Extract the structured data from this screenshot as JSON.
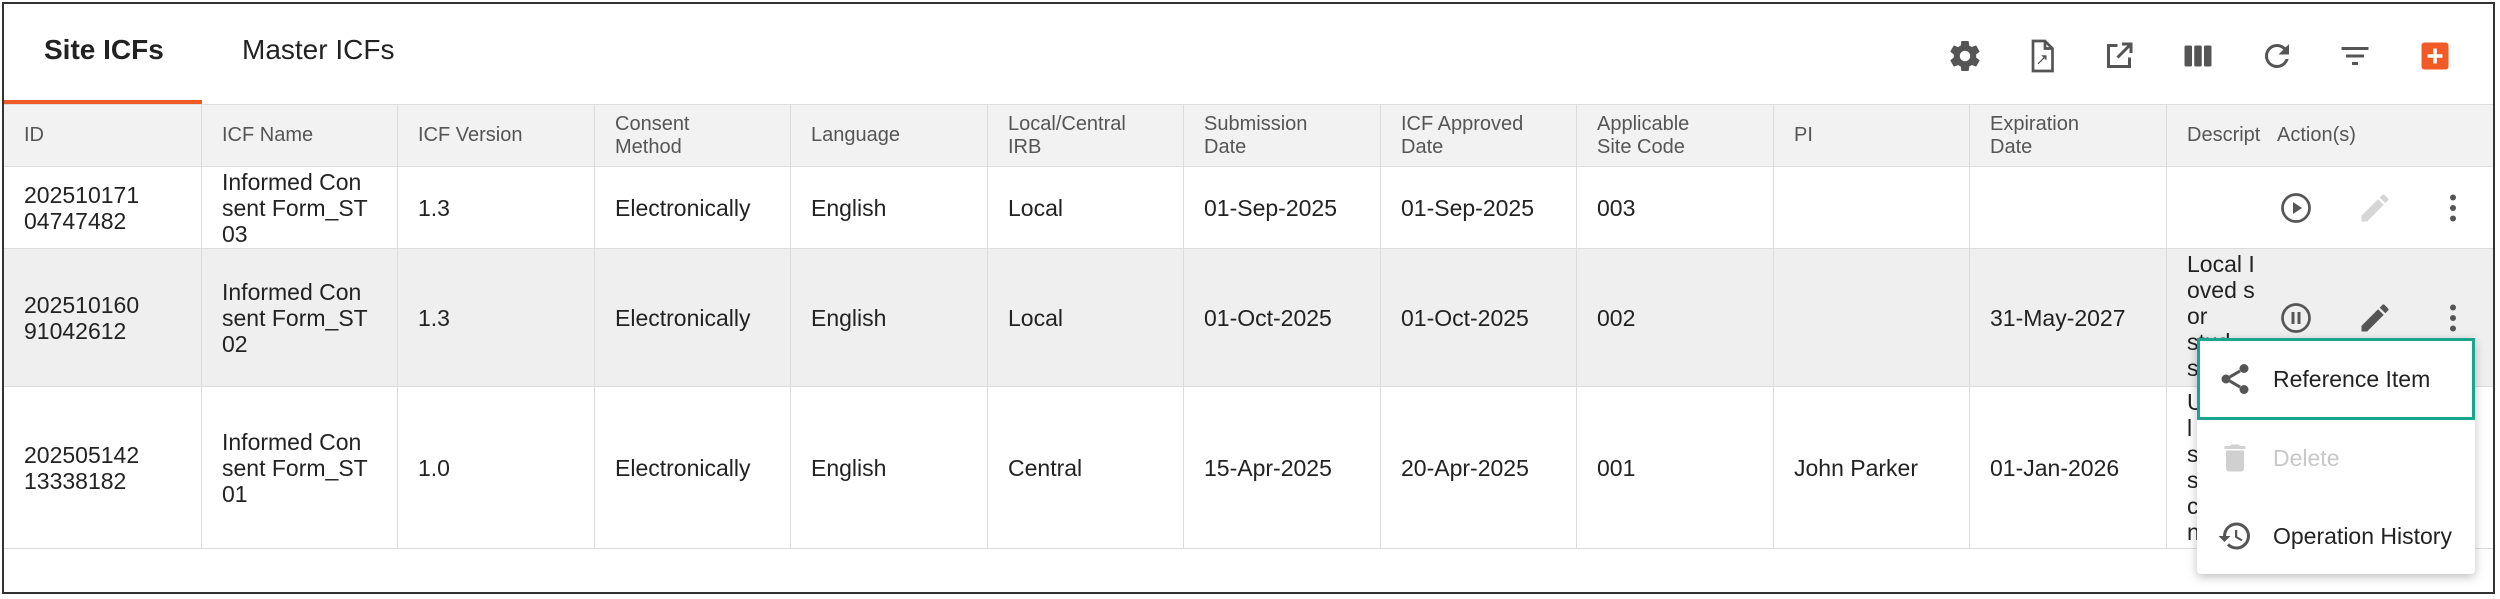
{
  "tabs": {
    "site": "Site ICFs",
    "master": "Master ICFs"
  },
  "columns": [
    "ID",
    "ICF Name",
    "ICF Version",
    "Consent\nMethod",
    "Language",
    "Local/Central\nIRB",
    "Submission\nDate",
    "ICF Approved\nDate",
    "Applicable\nSite Code",
    "PI",
    "Expiration\nDate",
    "Descript",
    "Action(s)"
  ],
  "rows": [
    {
      "id": "202510171\n04747482",
      "name": "Informed Con\nsent Form_ST\n03",
      "version": "1.3",
      "method": "Electronically",
      "language": "English",
      "irb": "Local",
      "submission": "01-Sep-2025",
      "approved": "01-Sep-2025",
      "site_code": "003",
      "pi": "",
      "expiration": "",
      "desc": ""
    },
    {
      "id": "202510160\n91042612",
      "name": "Informed Con\nsent Form_ST\n02",
      "version": "1.3",
      "method": "Electronically",
      "language": "English",
      "irb": "Local",
      "submission": "01-Oct-2025",
      "approved": "01-Oct-2025",
      "site_code": "002",
      "pi": "",
      "expiration": "31-May-2027",
      "desc": "Local I\noved s\nor stud\ns\n0"
    },
    {
      "id": "202505142\n13338182",
      "name": "Informed Con\nsent Form_ST\n01",
      "version": "1.0",
      "method": "Electronically",
      "language": "English",
      "irb": "Central",
      "submission": "15-Apr-2025",
      "approved": "20-Apr-2025",
      "site_code": "001",
      "pi": "John Parker",
      "expiration": "01-Jan-2026",
      "desc": "U\nl\ns\ns\nc\nn"
    }
  ],
  "menu": {
    "reference": "Reference Item",
    "delete": "Delete",
    "history": "Operation History"
  },
  "colors": {
    "accent": "#f15a24",
    "highlight": "#1aa58c",
    "icon": "#555555"
  },
  "toolbar_icons": [
    "gear-icon",
    "export-file-icon",
    "open-external-icon",
    "columns-icon",
    "refresh-icon",
    "filter-icon",
    "add-icon"
  ]
}
